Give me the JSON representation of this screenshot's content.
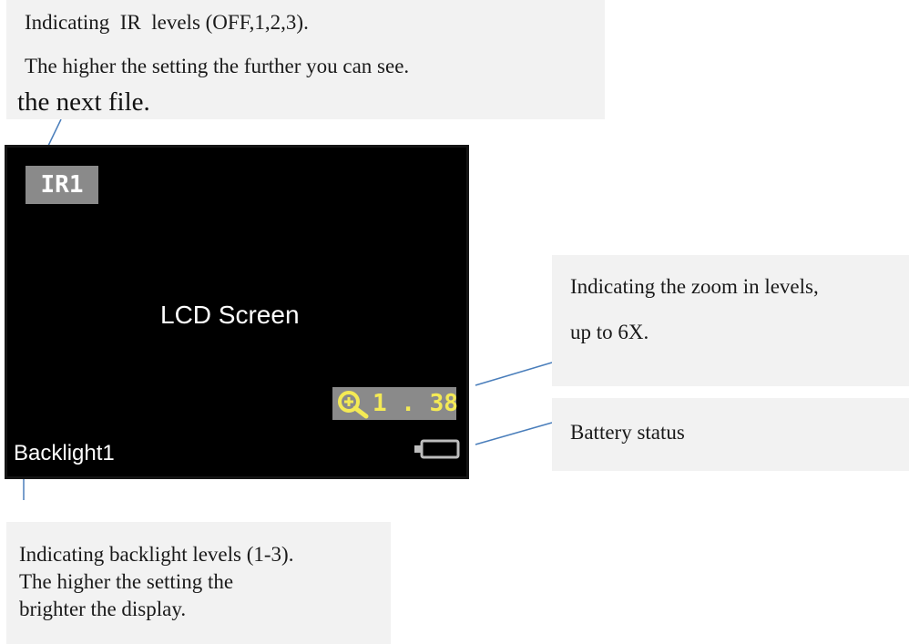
{
  "callouts": {
    "ir": {
      "line1": "Indicating  IR  levels (OFF,1,2,3).",
      "line2": "The higher the setting the further you can see.",
      "line3": "the next file."
    },
    "zoom": {
      "line1": "Indicating the zoom in levels,",
      "line2": "up to 6X."
    },
    "battery": {
      "line1": "Battery status"
    },
    "backlight": {
      "line1": "Indicating backlight levels (1-3).",
      "line2": "The higher the setting the",
      "line3": "brighter the display."
    }
  },
  "lcd": {
    "ir_indicator": "IR1",
    "screen_label": "LCD Screen",
    "zoom_value": "1 . 38",
    "backlight_indicator": "Backlight1",
    "icons": {
      "zoom": "zoom-in-magnifier-icon",
      "battery": "battery-icon"
    }
  },
  "colors": {
    "callout_background": "#f2f2f2",
    "leader_line": "#4a7ebb",
    "lcd_background": "#000000",
    "indicator_background": "#8a8a8a",
    "zoom_text": "#f4ea55"
  }
}
